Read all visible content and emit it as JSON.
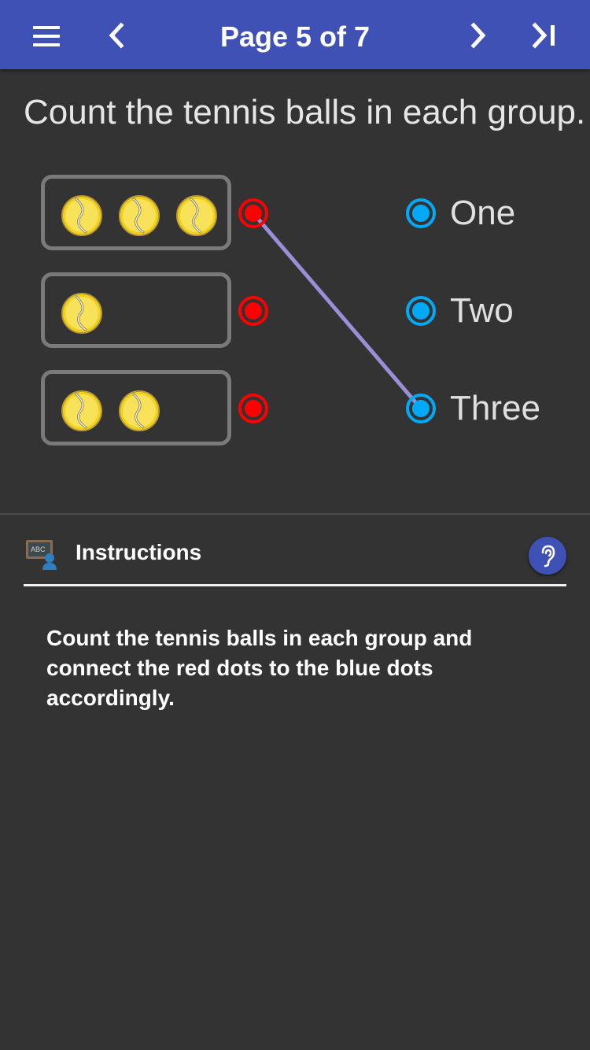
{
  "header": {
    "title": "Page 5 of 7",
    "icons": [
      "menu-icon",
      "chevron-left-icon",
      "chevron-right-icon",
      "skip-to-end-icon"
    ]
  },
  "question": "Count the tennis balls in each group.",
  "groups": [
    {
      "ball_count": 3
    },
    {
      "ball_count": 1
    },
    {
      "ball_count": 2
    }
  ],
  "options": [
    {
      "label": "One"
    },
    {
      "label": "Two"
    },
    {
      "label": "Three"
    }
  ],
  "connections": [
    {
      "from_group": 1,
      "to_option": 3
    }
  ],
  "instructions": {
    "title": "Instructions",
    "body": "Count the tennis balls in each group and connect the red dots to the blue dots accordingly."
  },
  "colors": {
    "header": "#3f51b5",
    "background": "#333333",
    "red_dot": "#ff0000",
    "blue_dot": "#03a9f4",
    "connector": "#9a8fd6",
    "group_border": "#7a7a7a"
  }
}
